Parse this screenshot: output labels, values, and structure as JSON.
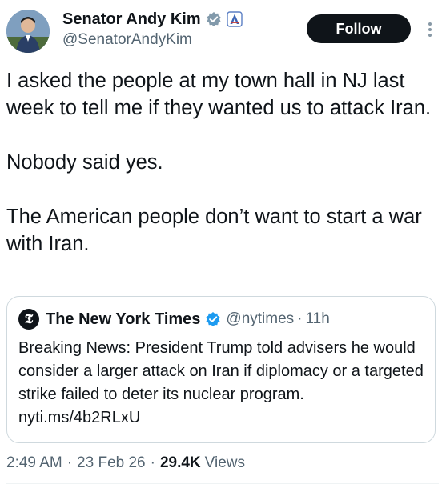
{
  "author": {
    "display_name": "Senator Andy Kim",
    "handle": "@SenatorAndyKim",
    "avatar_icon": "person-avatar",
    "verified_badge_icon": "gray-verified-badge-icon",
    "affiliation_badge_icon": "us-senate-badge-icon"
  },
  "actions": {
    "follow_label": "Follow",
    "more_icon": "vertical-ellipsis-icon"
  },
  "tweet": {
    "paragraphs": [
      "I asked the people at my town hall in NJ last week to tell me if they wanted us to attack Iran.",
      "Nobody said yes.",
      "The American people don’t want to start a war with Iran."
    ]
  },
  "quoted_tweet": {
    "logo_glyph": "𝕿",
    "logo_icon": "nyt-logo-icon",
    "display_name": "The New York Times",
    "verified_badge_icon": "gold-verified-badge-icon",
    "handle": "@nytimes",
    "separator": "·",
    "time": "11h",
    "text": "Breaking News: President Trump told advisers he would consider a larger attack on Iran if diplomacy or a targeted strike failed to deter its nuclear program. nyti.ms/4b2RLxU"
  },
  "meta": {
    "time": "2:49 AM",
    "separator": "·",
    "date": "23 Feb 26",
    "views_count": "29.4K",
    "views_label": "Views"
  },
  "colors": {
    "text_primary": "#0f1419",
    "text_secondary": "#536471",
    "follow_bg": "#0f1419",
    "border": "#cfd9de",
    "gray_badge": "#829aab",
    "gold_badge": "#1d9bf0"
  }
}
